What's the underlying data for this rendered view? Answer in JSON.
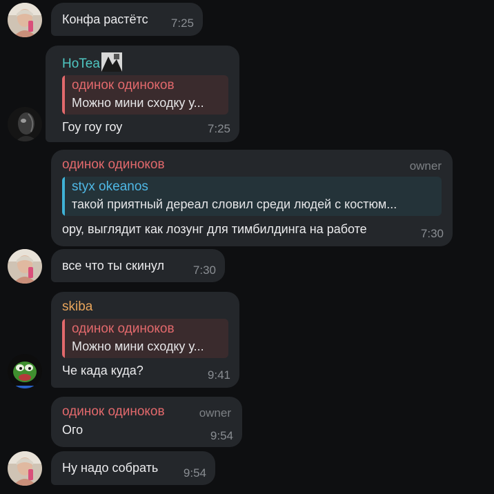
{
  "colors": {
    "background": "#0e0f11",
    "bubble": "#24272b",
    "name_red": "#e2696c",
    "name_teal": "#4fc7c2",
    "name_blue": "#4fb8e6",
    "name_orange": "#e8a55c",
    "muted": "#8a8e93"
  },
  "messages": [
    {
      "text": "Конфа растётс",
      "time": "7:25",
      "avatar": "user-photo-avatar"
    },
    {
      "sender": "HoTea",
      "reply_to": {
        "name": "одинок одиноков",
        "text": "Можно мини сходку у..."
      },
      "text": "Гоу гоу гоу",
      "time": "7:25",
      "avatar": "dark-portrait-avatar"
    },
    {
      "sender": "одинок одиноков",
      "role": "owner",
      "reply_to": {
        "name": "styx okeanos",
        "text": "такой приятный дереал словил среди людей с костюм..."
      },
      "text": "ору, выглядит как лозунг для тимбилдинга на работе",
      "time": "7:30"
    },
    {
      "text": "все что ты скинул",
      "time": "7:30",
      "avatar": "user-photo-avatar"
    },
    {
      "sender": "skiba",
      "reply_to": {
        "name": "одинок одиноков",
        "text": "Можно мини сходку у..."
      },
      "text": "Че када куда?",
      "time": "9:41",
      "avatar": "pepe-frog-avatar"
    },
    {
      "sender": "одинок одиноков",
      "role": "owner",
      "text": "Ого",
      "time": "9:54"
    },
    {
      "text": "Ну надо собрать",
      "time": "9:54",
      "avatar": "user-photo-avatar"
    }
  ]
}
